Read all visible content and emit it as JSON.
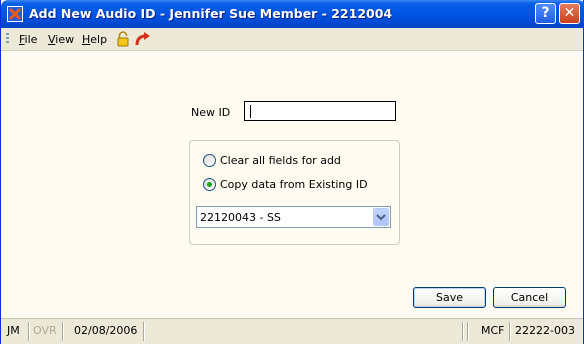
{
  "window": {
    "title": "Add New Audio ID - Jennifer Sue Member - 2212004",
    "help_glyph": "?",
    "close_glyph": "✕"
  },
  "menu": {
    "items": [
      {
        "underline": "F",
        "rest": "ile"
      },
      {
        "underline": "V",
        "rest": "iew"
      },
      {
        "underline": "H",
        "rest": "elp"
      }
    ]
  },
  "form": {
    "new_id_label": "New ID",
    "new_id_value": "",
    "radio_clear_label": "Clear all fields for add",
    "radio_copy_label": "Copy data from Existing ID",
    "selected_radio": "copy",
    "existing_id_selected": "22120043 - SS"
  },
  "buttons": {
    "save": "Save",
    "cancel": "Cancel"
  },
  "status": {
    "user": "JM",
    "mode": "OVR",
    "date": "02/08/2006",
    "code": "MCF",
    "account": "22222-003"
  },
  "colors": {
    "title_bar": "#0054e3",
    "window_bg": "#fffbf0",
    "status_disabled": "#aca899"
  }
}
